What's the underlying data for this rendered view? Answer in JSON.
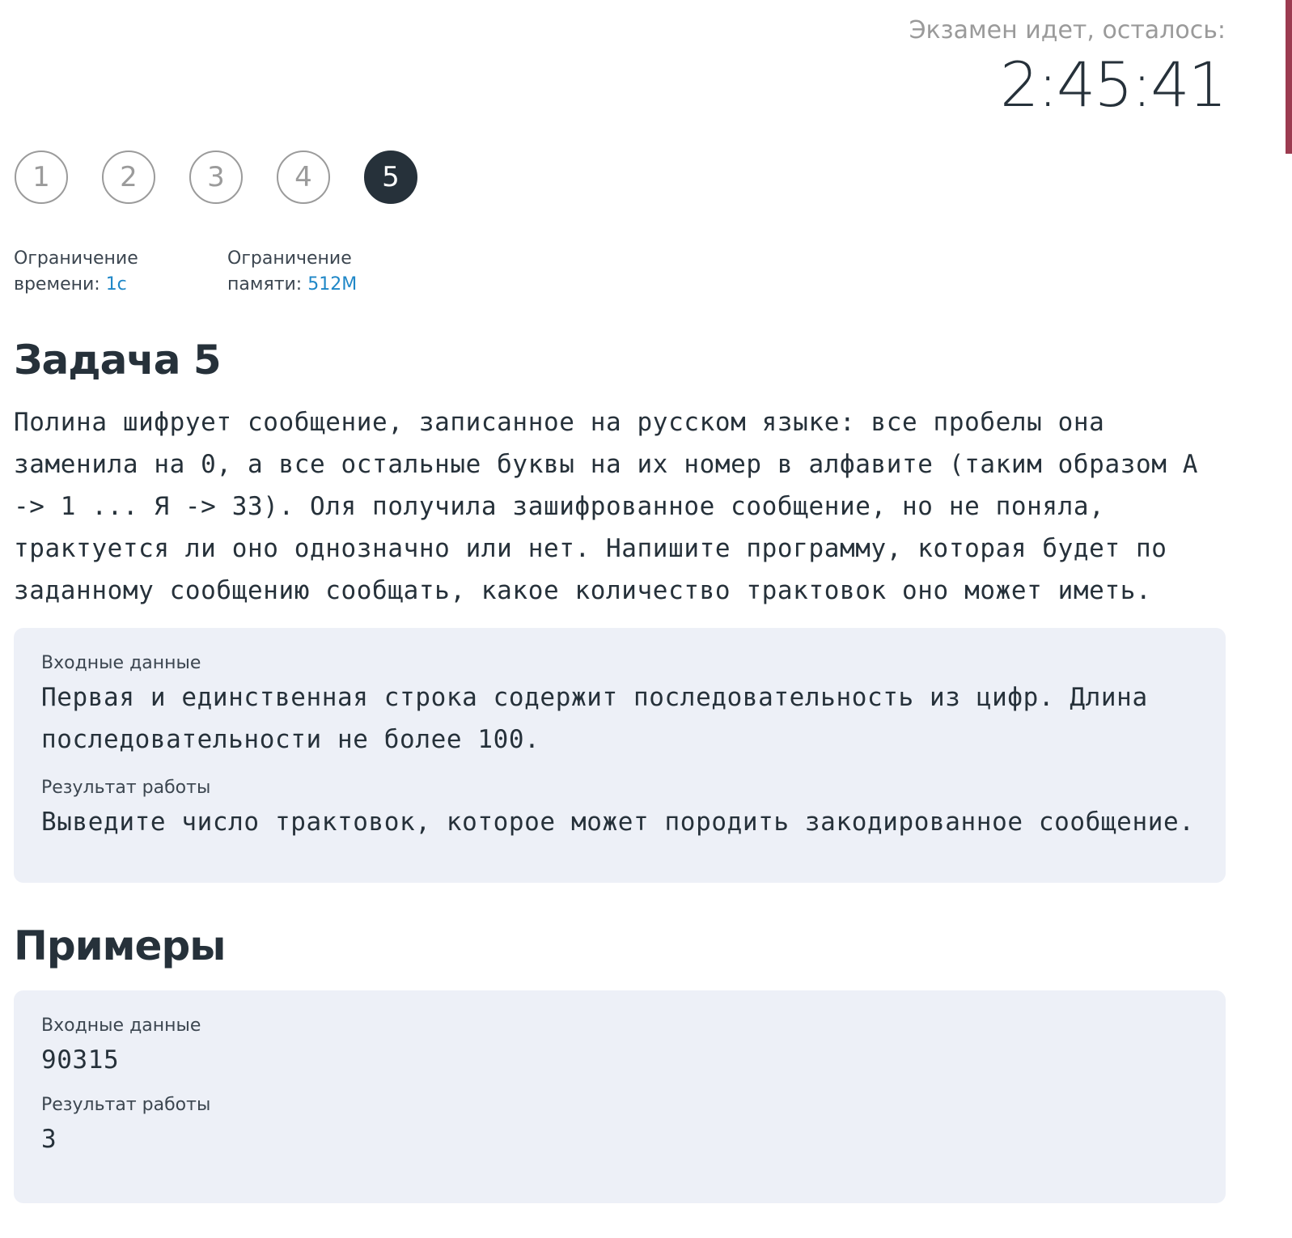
{
  "timer": {
    "label": "Экзамен идет, осталось:",
    "value": "2:45:41"
  },
  "tasks": [
    {
      "label": "1",
      "active": false
    },
    {
      "label": "2",
      "active": false
    },
    {
      "label": "3",
      "active": false
    },
    {
      "label": "4",
      "active": false
    },
    {
      "label": "5",
      "active": true
    }
  ],
  "limits": {
    "time_label_line1": "Ограничение",
    "time_label_line2": "времени: ",
    "time_value": "1с",
    "memory_label_line1": "Ограничение",
    "memory_label_line2": "памяти: ",
    "memory_value": "512M"
  },
  "problem": {
    "title": "Задача 5",
    "statement": "Полина шифрует сообщение, записанное на русском языке: все пробелы она заменила на 0, а все остальные буквы на их номер в алфавите (таким образом А -> 1 ... Я -> 33). Оля получила зашифрованное сообщение, но не поняла, трактуется ли оно однозначно или нет. Напишите программу, которая будет по заданному сообщению сообщать, какое количество трактовок оно может иметь.",
    "input_label": "Входные данные",
    "input_text": "Первая и единственная строка содержит последовательность из цифр. Длина последовательности не более 100.",
    "output_label": "Результат работы",
    "output_text": "Выведите число трактовок, которое может породить закодированное сообщение."
  },
  "examples": {
    "title": "Примеры",
    "items": [
      {
        "input_label": "Входные данные",
        "input": "90315",
        "output_label": "Результат работы",
        "output": "3"
      }
    ]
  },
  "colors": {
    "accent": "#1f87c7",
    "active_task": "#26313a",
    "panel_bg": "#edf0f7",
    "scrollbar": "#9c3b50"
  }
}
